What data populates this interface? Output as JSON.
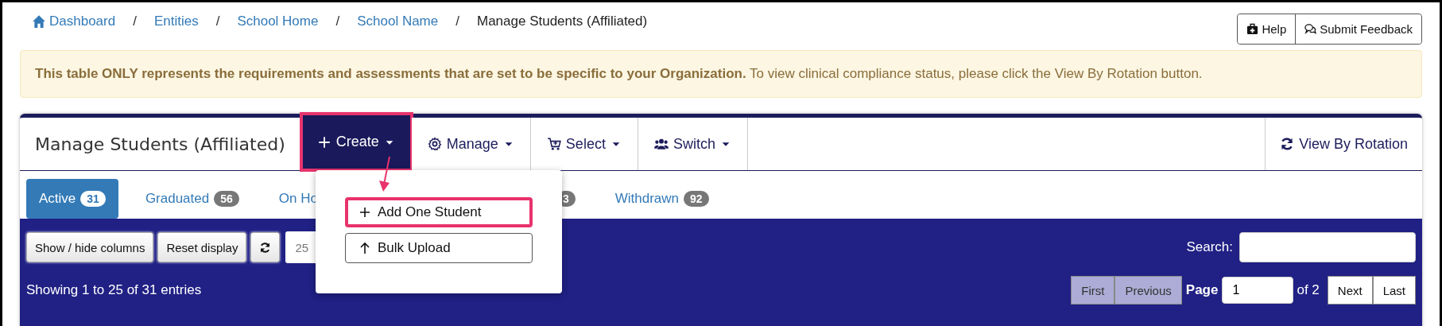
{
  "breadcrumb": {
    "separator": "/",
    "items": [
      {
        "label": "Dashboard",
        "kind": "home"
      },
      {
        "label": "Entities",
        "kind": "link"
      },
      {
        "label": "School Home",
        "kind": "link"
      },
      {
        "label": "School Name",
        "kind": "link"
      },
      {
        "label": "Manage Students (Affiliated)",
        "kind": "current"
      }
    ]
  },
  "header_buttons": [
    {
      "label": "Help",
      "kind": "medkit"
    },
    {
      "label": "Submit Feedback",
      "kind": "comments"
    }
  ],
  "alert": {
    "text": "**This table ONLY represents the requirements and assessments that are set to be specific to your Organization.** To view clinical compliance status, please click the View By Rotation button."
  },
  "card": {
    "title": "Manage Students (Affiliated)",
    "menu": [
      {
        "label": "Create",
        "kind": "plus",
        "highlighted": true
      },
      {
        "label": "Manage",
        "kind": "gear",
        "highlighted": false
      },
      {
        "label": "Select",
        "kind": "cart",
        "highlighted": false
      },
      {
        "label": "Switch",
        "kind": "users",
        "highlighted": false
      }
    ],
    "view_button": {
      "label": "View By Rotation"
    }
  },
  "create_menu": {
    "open": true,
    "callout_arrow": true,
    "items": [
      {
        "label": "Add One Student",
        "kind": "plus",
        "highlighted": true
      },
      {
        "label": "Bulk Upload",
        "kind": "upload",
        "highlighted": false
      }
    ]
  },
  "status_tabs": [
    {
      "label": "Active",
      "count": "31",
      "selected": true
    },
    {
      "label": "Graduated",
      "count": "56",
      "selected": false
    },
    {
      "label": "On Ho",
      "selected": false
    },
    {
      "count": "3",
      "selected": false
    },
    {
      "label": "Withdrawn",
      "count": "92",
      "selected": false
    }
  ],
  "table_controls": {
    "buttons": [
      {
        "label": "Show / hide columns",
        "kind": "text"
      },
      {
        "label": "Reset display",
        "kind": "text"
      },
      {
        "kind": "refresh"
      }
    ],
    "page_length": "25",
    "search_label": "Search:",
    "info": "Showing 1 to 25 of 31 entries",
    "pagination": {
      "before": [
        {
          "label": "First",
          "disabled": true
        },
        {
          "label": "Previous",
          "disabled": true
        }
      ],
      "page_label": "Page",
      "page_value": "1",
      "of_text": "of 2",
      "after": [
        {
          "label": "Next",
          "disabled": false
        },
        {
          "label": "Last",
          "disabled": false
        }
      ]
    }
  }
}
